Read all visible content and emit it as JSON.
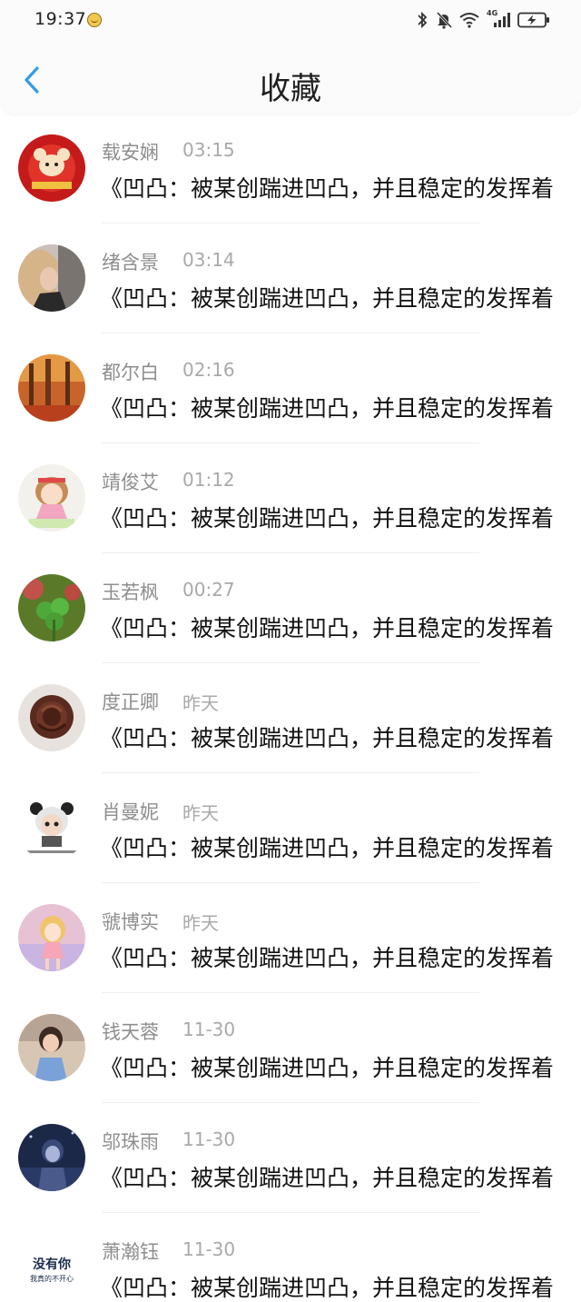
{
  "status_bar": {
    "time": "19:37",
    "network_label": "4G"
  },
  "header": {
    "title": "收藏"
  },
  "items": [
    {
      "name": "载安娴",
      "time": "03:15",
      "message": "《凹凸：被某创踹进凹凸，并且稳定的发挥着",
      "avatar": "red-mouse-avatar"
    },
    {
      "name": "绪含景",
      "time": "03:14",
      "message": "《凹凸：被某创踹进凹凸，并且稳定的发挥着",
      "avatar": "girl-portrait-avatar"
    },
    {
      "name": "都尔白",
      "time": "02:16",
      "message": "《凹凸：被某创踹进凹凸，并且稳定的发挥着",
      "avatar": "autumn-forest-avatar"
    },
    {
      "name": "靖俊艾",
      "time": "01:12",
      "message": "《凹凸：被某创踹进凹凸，并且稳定的发挥着",
      "avatar": "cartoon-girl-avatar"
    },
    {
      "name": "玉若枫",
      "time": "00:27",
      "message": "《凹凸：被某创踹进凹凸，并且稳定的发挥着",
      "avatar": "clover-avatar"
    },
    {
      "name": "度正卿",
      "time": "昨天",
      "message": "《凹凸：被某创踹进凹凸，并且稳定的发挥着",
      "avatar": "chocolate-rose-avatar"
    },
    {
      "name": "肖曼妮",
      "time": "昨天",
      "message": "《凹凸：被某创踹进凹凸，并且稳定的发挥着",
      "avatar": "panda-doll-avatar"
    },
    {
      "name": "虢博实",
      "time": "昨天",
      "message": "《凹凸：被某创踹进凹凸，并且稳定的发挥着",
      "avatar": "anime-girl-avatar"
    },
    {
      "name": "钱天蓉",
      "time": "11-30",
      "message": "《凹凸：被某创踹进凹凸，并且稳定的发挥着",
      "avatar": "child-photo-avatar"
    },
    {
      "name": "邬珠雨",
      "time": "11-30",
      "message": "《凹凸：被某创踹进凹凸，并且稳定的发挥着",
      "avatar": "night-boy-avatar"
    },
    {
      "name": "萧瀚钰",
      "time": "11-30",
      "message": "《凹凸：被某创踹进凹凸，并且稳定的发挥着",
      "avatar": "text-avatar"
    }
  ],
  "avatar_text": {
    "line1": "没有你",
    "line2": "我真的不开心"
  },
  "colors": {
    "accent": "#2f9cf0",
    "name": "#8e8e8e",
    "time": "#a9a9a9",
    "message": "#111111"
  }
}
